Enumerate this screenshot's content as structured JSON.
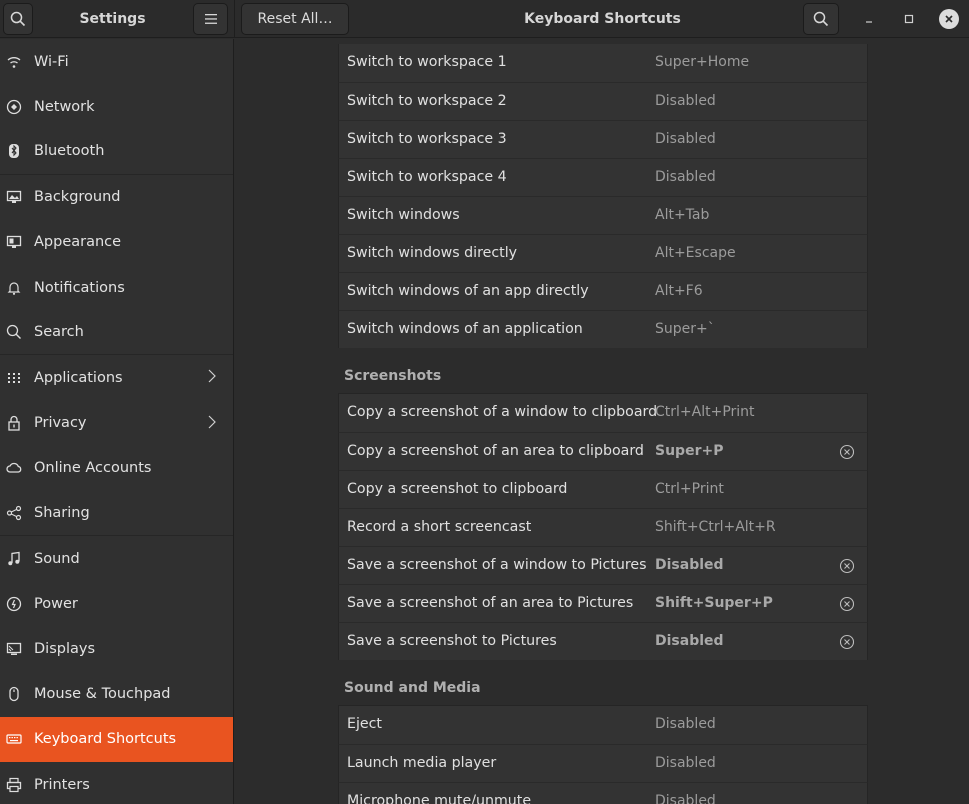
{
  "header": {
    "sidebar_title": "Settings",
    "reset_label": "Reset All…",
    "page_title": "Keyboard Shortcuts"
  },
  "sidebar": {
    "items": [
      {
        "label": "Wi-Fi",
        "icon": "wifi-icon"
      },
      {
        "label": "Network",
        "icon": "network-icon"
      },
      {
        "label": "Bluetooth",
        "icon": "bluetooth-icon"
      },
      {
        "label": "Background",
        "icon": "background-icon"
      },
      {
        "label": "Appearance",
        "icon": "appearance-icon"
      },
      {
        "label": "Notifications",
        "icon": "bell-icon"
      },
      {
        "label": "Search",
        "icon": "search-icon"
      },
      {
        "label": "Applications",
        "icon": "grid-icon"
      },
      {
        "label": "Privacy",
        "icon": "lock-icon"
      },
      {
        "label": "Online Accounts",
        "icon": "cloud-icon"
      },
      {
        "label": "Sharing",
        "icon": "share-icon"
      },
      {
        "label": "Sound",
        "icon": "music-note-icon"
      },
      {
        "label": "Power",
        "icon": "power-icon"
      },
      {
        "label": "Displays",
        "icon": "display-icon"
      },
      {
        "label": "Mouse & Touchpad",
        "icon": "mouse-icon"
      },
      {
        "label": "Keyboard Shortcuts",
        "icon": "keyboard-icon"
      },
      {
        "label": "Printers",
        "icon": "printer-icon"
      }
    ]
  },
  "shortcuts": {
    "navigation_rows": [
      {
        "label": "Switch to workspace 1",
        "accel": "Super+Home"
      },
      {
        "label": "Switch to workspace 2",
        "accel": "Disabled"
      },
      {
        "label": "Switch to workspace 3",
        "accel": "Disabled"
      },
      {
        "label": "Switch to workspace 4",
        "accel": "Disabled"
      },
      {
        "label": "Switch windows",
        "accel": "Alt+Tab"
      },
      {
        "label": "Switch windows directly",
        "accel": "Alt+Escape"
      },
      {
        "label": "Switch windows of an app directly",
        "accel": "Alt+F6"
      },
      {
        "label": "Switch windows of an application",
        "accel": "Super+`"
      }
    ],
    "screenshots_title": "Screenshots",
    "screenshots_rows": [
      {
        "label": "Copy a screenshot of a window to clipboard",
        "accel": "Ctrl+Alt+Print"
      },
      {
        "label": "Copy a screenshot of an area to clipboard",
        "accel": "Super+P"
      },
      {
        "label": "Copy a screenshot to clipboard",
        "accel": "Ctrl+Print"
      },
      {
        "label": "Record a short screencast",
        "accel": "Shift+Ctrl+Alt+R"
      },
      {
        "label": "Save a screenshot of a window to Pictures",
        "accel": "Disabled"
      },
      {
        "label": "Save a screenshot of an area to Pictures",
        "accel": "Shift+Super+P"
      },
      {
        "label": "Save a screenshot to Pictures",
        "accel": "Disabled"
      }
    ],
    "media_title": "Sound and Media",
    "media_rows": [
      {
        "label": "Eject",
        "accel": "Disabled"
      },
      {
        "label": "Launch media player",
        "accel": "Disabled"
      },
      {
        "label": "Microphone mute/unmute",
        "accel": "Disabled"
      }
    ]
  },
  "colors": {
    "accent": "#e95420",
    "background": "#2c2c2c",
    "row": "#333333"
  }
}
